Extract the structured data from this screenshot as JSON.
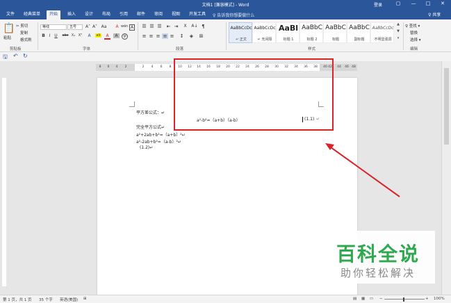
{
  "window": {
    "title": "文档1 [兼容模式] - Word",
    "login": "登录",
    "minimize": "—",
    "restore": "▢",
    "maximize": "□",
    "close": "✕"
  },
  "tabs": [
    {
      "label": "文件"
    },
    {
      "label": "经典菜单"
    },
    {
      "label": "开始"
    },
    {
      "label": "插入"
    },
    {
      "label": "设计"
    },
    {
      "label": "布局"
    },
    {
      "label": "引用"
    },
    {
      "label": "邮件"
    },
    {
      "label": "审阅"
    },
    {
      "label": "视图"
    },
    {
      "label": "开发工具"
    }
  ],
  "active_tab": "开始",
  "tell_me": "♀ 告诉我你想要做什么",
  "share": "♀ 共享",
  "clipboard": {
    "paste": "粘贴",
    "cut": "✂ 剪切",
    "copy": "复制",
    "format_painter": "格式刷",
    "group": "剪贴板"
  },
  "font": {
    "name": "等线",
    "size": "五号",
    "group": "字体",
    "bold": "B",
    "italic": "I",
    "underline": "U",
    "strike": "abc",
    "subscript": "X₂",
    "superscript": "X²",
    "grow": "A˄",
    "shrink": "A˅",
    "case": "Aa",
    "clear": "A",
    "wen": "wén",
    "border_char": "A",
    "effects": "A",
    "highlight": "ab",
    "color": "A",
    "shade": "A",
    "circle": "字"
  },
  "paragraph": {
    "group": "段落",
    "bullets": "☰",
    "numbering": "☰",
    "multilevel": "☰",
    "decrease_indent": "⇤",
    "increase_indent": "⇥",
    "chinese_layout": "X",
    "sort": "A↓",
    "show_marks": "¶",
    "align_left": "≡",
    "align_center": "≡",
    "align_right": "≡",
    "justify": "≡",
    "distributed": "≡",
    "line_spacing": "↕",
    "shading": "◈",
    "borders": "⊞"
  },
  "styles": {
    "group": "样式",
    "items": [
      {
        "preview": "AaBbCcDc",
        "name": "↵ 正文"
      },
      {
        "preview": "AaBbCcDc",
        "name": "↵ 无间隔"
      },
      {
        "preview": "AaBl",
        "name": "标题 1"
      },
      {
        "preview": "AaBbC",
        "name": "标题 2"
      },
      {
        "preview": "AaBbC",
        "name": "标题"
      },
      {
        "preview": "AaBbC",
        "name": "副标题"
      },
      {
        "preview": "AaBbCcDc",
        "name": "不明显强调"
      }
    ]
  },
  "editing": {
    "group": "编辑",
    "find": "♀ 查找 ▾",
    "replace": "替换",
    "select": "选择 ▾"
  },
  "qat": {
    "save": "🖫",
    "undo": "↶",
    "redo": "↻"
  },
  "ruler": {
    "ticks_left": [
      "8",
      "6",
      "4",
      "2"
    ],
    "ticks_right": [
      "2",
      "4",
      "6",
      "8",
      "10",
      "12",
      "14",
      "16",
      "18",
      "20",
      "22",
      "24",
      "26",
      "28",
      "30",
      "32",
      "34",
      "36",
      "38",
      "40",
      "42",
      "44",
      "46",
      "48"
    ]
  },
  "document": {
    "line1": "平方差公式：↵",
    "equation": "a²-b²=（a+b）（a-b）",
    "eq_num": "(1.1)",
    "eq_mark": "↵",
    "line3": "完全平方公式↵",
    "line4": "a²+2ab+b²=（a+b）²↵",
    "line5": "a²-2ab+b²=（a-b）²↵",
    "line6": "(1.2)↵"
  },
  "status": {
    "page": "第 1 页，共 1 页",
    "words": "35 个字",
    "lang": "英语(美国)",
    "macro": "⊞",
    "zoom": "100%",
    "zoom_minus": "−",
    "zoom_plus": "+"
  },
  "watermark": {
    "main": "百科全说",
    "sub": "助你轻松解决"
  },
  "colors": {
    "brand": "#2b579a",
    "annotation_red": "#d9232a",
    "watermark_green": "#2fa84f"
  }
}
